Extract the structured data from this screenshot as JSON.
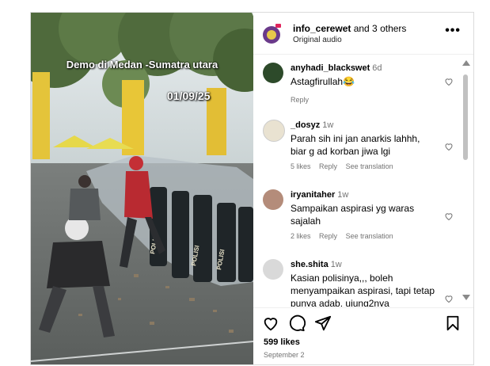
{
  "video": {
    "overlay_title": "Demo di Medan -Sumatra utara",
    "overlay_date": "01/09/25"
  },
  "header": {
    "username": "info_cerewet",
    "collaborators": "and 3 others",
    "audio": "Original audio",
    "more": "•••"
  },
  "comments": [
    {
      "user": "anyhadi_blackswet",
      "ago": "6d",
      "text": "Astagfirullah😂",
      "reply": "Reply",
      "likes": "",
      "translate": ""
    },
    {
      "user": "_dosyz",
      "ago": "1w",
      "text": "Parah sih ini jan anarkis lahhh, biar g ad korban jiwa lgi",
      "reply": "Reply",
      "likes": "5 likes",
      "translate": "See translation"
    },
    {
      "user": "iryanitaher",
      "ago": "1w",
      "text": "Sampaikan aspirasi yg waras sajalah",
      "reply": "Reply",
      "likes": "2 likes",
      "translate": "See translation"
    },
    {
      "user": "she.shita",
      "ago": "1w",
      "text": "Kasian polisinya,,, boleh menyampaikan aspirasi, tapi tetap punya adab, ujung2nya",
      "reply": "",
      "likes": "",
      "translate": ""
    }
  ],
  "footer": {
    "likes": "599 likes",
    "date": "September 2"
  },
  "colors": {
    "avatar_brand": "#6a3a8a",
    "scroll_thumb": "#c1c1c1"
  },
  "icons": [
    "heart-icon",
    "comment-icon",
    "share-icon",
    "bookmark-icon",
    "more-icon"
  ]
}
